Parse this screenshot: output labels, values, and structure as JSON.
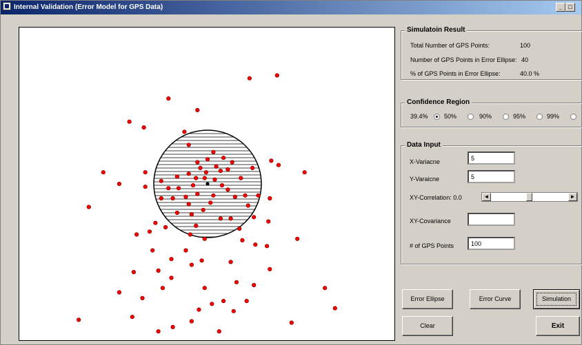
{
  "window": {
    "title": "Internal Validation (Error Model for GPS Data)",
    "controls": {
      "minimize": "_",
      "maximize": "□",
      "close": "×"
    }
  },
  "simulation_result": {
    "title": "Simulatoin Result",
    "total_label": "Total Number of GPS Points:",
    "total_value": "100",
    "in_ellipse_label": "Number of GPS Points in Error Ellipse:",
    "in_ellipse_value": "40",
    "pct_label": "% of GPS Points in Error Ellipse:",
    "pct_value": "40.0 %"
  },
  "confidence_region": {
    "title": "Confidence Region",
    "options": [
      {
        "label": "39.4%",
        "selected": true
      },
      {
        "label": "50%",
        "selected": false
      },
      {
        "label": "90%",
        "selected": false
      },
      {
        "label": "95%",
        "selected": false
      },
      {
        "label": "99%",
        "selected": false
      }
    ]
  },
  "data_input": {
    "title": "Data Input",
    "x_variance_label": "X-Variacne",
    "x_variance_value": "5",
    "y_variance_label": "Y-Varaicne",
    "y_variance_value": "5",
    "correlation_label": "XY-Correlation: 0.0",
    "correlation_value": 0.0,
    "covariance_label": "XY-Covariance",
    "covariance_value": "",
    "points_label": "# of GPS Points",
    "points_value": "100"
  },
  "buttons": {
    "error_ellipse": "Error Ellipse",
    "error_curve": "Error Curve",
    "simulation": "Simulation",
    "clear": "Clear",
    "exit": "Exit"
  },
  "scrollbar": {
    "left": "◄",
    "right": "►"
  },
  "plot": {
    "point_color": "#ff0000",
    "ellipse_fill": "hatched",
    "center": [
      0,
      0
    ],
    "points": [
      [
        -5.4,
        4.3
      ],
      [
        -1.6,
        3.6
      ],
      [
        -4.4,
        3.9
      ],
      [
        2.9,
        7.3
      ],
      [
        4.8,
        7.5
      ],
      [
        -2.7,
        5.9
      ],
      [
        -0.7,
        5.1
      ],
      [
        -1.3,
        2.7
      ],
      [
        0.4,
        2.2
      ],
      [
        1.7,
        1.5
      ],
      [
        1.1,
        1.8
      ],
      [
        0,
        1.7
      ],
      [
        -0.7,
        1.5
      ],
      [
        0.6,
        1.2
      ],
      [
        -0.5,
        1.1
      ],
      [
        -0.1,
        0.8
      ],
      [
        1.4,
        1.0
      ],
      [
        4.4,
        1.6
      ],
      [
        4.9,
        1.3
      ],
      [
        3.1,
        1.1
      ],
      [
        -7.2,
        0.8
      ],
      [
        -4.3,
        0.8
      ],
      [
        -3.2,
        0.2
      ],
      [
        -2.1,
        0.5
      ],
      [
        -1.3,
        0.7
      ],
      [
        -0.8,
        0.4
      ],
      [
        -0.2,
        0.4
      ],
      [
        0.5,
        0.3
      ],
      [
        0.9,
        0.9
      ],
      [
        2.3,
        0.4
      ],
      [
        6.7,
        0.8
      ],
      [
        -6.1,
        0
      ],
      [
        -4.3,
        -0.2
      ],
      [
        -2.7,
        -0.3
      ],
      [
        -2.0,
        -0.3
      ],
      [
        -1.0,
        -0.1
      ],
      [
        1.0,
        -0.1
      ],
      [
        1.4,
        -0.4
      ],
      [
        2.6,
        -0.8
      ],
      [
        -2.4,
        -1.0
      ],
      [
        -1.5,
        -0.9
      ],
      [
        -0.7,
        -0.7
      ],
      [
        0.4,
        -0.8
      ],
      [
        1.9,
        -0.9
      ],
      [
        3.5,
        -0.8
      ],
      [
        4.3,
        -1.0
      ],
      [
        -8.2,
        -1.6
      ],
      [
        -3.2,
        -1.0
      ],
      [
        -1.3,
        -1.4
      ],
      [
        0.2,
        -1.3
      ],
      [
        2.8,
        -1.5
      ],
      [
        -0.3,
        -1.8
      ],
      [
        -2.1,
        -2.0
      ],
      [
        -1.1,
        -2.1
      ],
      [
        0.9,
        -2.4
      ],
      [
        3.2,
        -2.3
      ],
      [
        4.2,
        -2.6
      ],
      [
        -3.6,
        -2.7
      ],
      [
        -2.9,
        -3.0
      ],
      [
        -0.8,
        -2.9
      ],
      [
        1.6,
        -2.4
      ],
      [
        2.2,
        -3.1
      ],
      [
        6.2,
        -3.8
      ],
      [
        -4.9,
        -3.5
      ],
      [
        -4.0,
        -3.3
      ],
      [
        -0.2,
        -3.8
      ],
      [
        -1.2,
        -3.5
      ],
      [
        2.4,
        -3.9
      ],
      [
        -3.8,
        -4.6
      ],
      [
        -1.5,
        -4.6
      ],
      [
        -2.5,
        -5.2
      ],
      [
        -1.1,
        -5.6
      ],
      [
        1.6,
        -5.4
      ],
      [
        -5.1,
        -6.1
      ],
      [
        -3.4,
        -6.0
      ],
      [
        -0.4,
        -5.3
      ],
      [
        3.3,
        -4.2
      ],
      [
        4.1,
        -4.3
      ],
      [
        -2.5,
        -6.5
      ],
      [
        2.0,
        -6.8
      ],
      [
        -3.1,
        -7.2
      ],
      [
        -0.2,
        -7.2
      ],
      [
        4.3,
        -5.9
      ],
      [
        8.1,
        -7.2
      ],
      [
        -4.5,
        -7.9
      ],
      [
        0.3,
        -8.3
      ],
      [
        -6.1,
        -7.5
      ],
      [
        3.2,
        -7.0
      ],
      [
        1.8,
        -8.8
      ],
      [
        -1.1,
        -9.5
      ],
      [
        -5.2,
        -9.2
      ],
      [
        -2.4,
        -9.9
      ],
      [
        1.1,
        -8.1
      ],
      [
        -0.6,
        -8.7
      ],
      [
        2.7,
        -8.1
      ],
      [
        0.8,
        -10.2
      ],
      [
        -3.4,
        -10.2
      ],
      [
        -8.9,
        -9.4
      ],
      [
        5.8,
        -9.6
      ],
      [
        8.8,
        -8.6
      ]
    ]
  }
}
